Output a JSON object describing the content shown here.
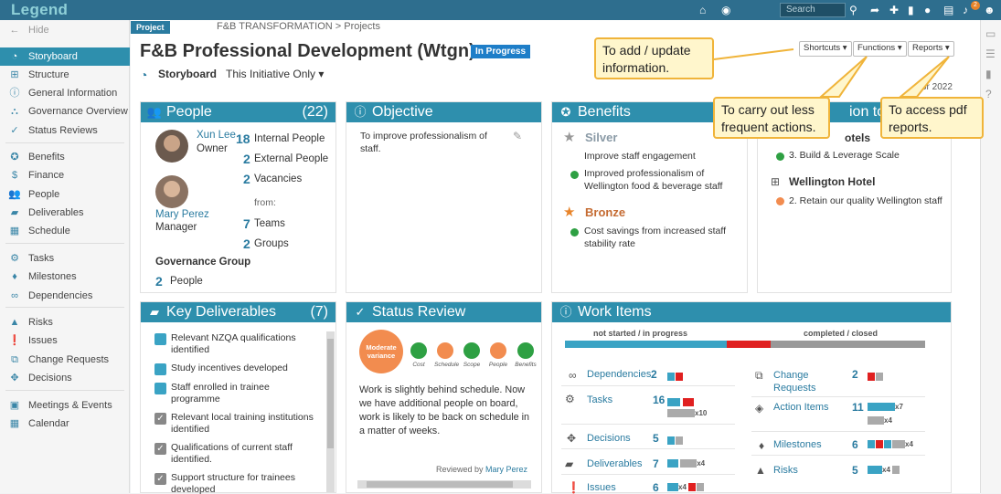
{
  "topbar": {
    "logo": "Legend",
    "search_placeholder": "Search",
    "notification_count": "2"
  },
  "sidebar": {
    "hide": "Hide",
    "items": [
      {
        "label": "Storyboard",
        "icon": "dashboard-icon"
      },
      {
        "label": "Structure",
        "icon": "sitemap-icon"
      },
      {
        "label": "General Information",
        "icon": "info-icon"
      },
      {
        "label": "Governance Overview",
        "icon": "governance-icon"
      },
      {
        "label": "Status Reviews",
        "icon": "check-double-icon"
      },
      {
        "label": "Benefits",
        "icon": "award-icon"
      },
      {
        "label": "Finance",
        "icon": "dollar-icon"
      },
      {
        "label": "People",
        "icon": "people-icon"
      },
      {
        "label": "Deliverables",
        "icon": "truck-icon"
      },
      {
        "label": "Schedule",
        "icon": "calendar-icon"
      },
      {
        "label": "Tasks",
        "icon": "cogs-icon"
      },
      {
        "label": "Milestones",
        "icon": "diamond-icon"
      },
      {
        "label": "Dependencies",
        "icon": "link-icon"
      },
      {
        "label": "Risks",
        "icon": "warning-icon"
      },
      {
        "label": "Issues",
        "icon": "exclamation-icon"
      },
      {
        "label": "Change Requests",
        "icon": "change-icon"
      },
      {
        "label": "Decisions",
        "icon": "arrows-icon"
      },
      {
        "label": "Meetings & Events",
        "icon": "calendar-event-icon"
      },
      {
        "label": "Calendar",
        "icon": "calendar-grid-icon"
      }
    ]
  },
  "header": {
    "tag": "Project",
    "breadcrumb": "F&B TRANSFORMATION > Projects",
    "title": "F&B Professional Development (Wtgn)",
    "status": "In Progress",
    "view": "Storyboard",
    "filter": "This Initiative Only",
    "shortcuts": "Shortcuts",
    "functions": "Functions",
    "reports": "Reports",
    "date_partial": "or 2022"
  },
  "callouts": {
    "update": "To add / update information.",
    "functions": "To carry out less frequent actions.",
    "reports": "To access pdf reports."
  },
  "people": {
    "title": "People",
    "count": "(22)",
    "owner_name": "Xun Lee",
    "owner_role": "Owner",
    "manager_name": "Mary Perez",
    "manager_role": "Manager",
    "internal_num": "18",
    "internal_label": "Internal People",
    "external_num": "2",
    "external_label": "External People",
    "vacancies_num": "2",
    "vacancies_label": "Vacancies",
    "from": "from:",
    "teams_num": "7",
    "teams_label": "Teams",
    "groups_num": "2",
    "groups_label": "Groups",
    "gov_title": "Governance Group",
    "gov_num": "2",
    "gov_label": "People"
  },
  "objective": {
    "title": "Objective",
    "text": "To improve professionalism of staff."
  },
  "benefits": {
    "title": "Benefits",
    "silver": "Silver",
    "silver_items": [
      "Improve staff engagement",
      "Improved professionalism of Wellington food & beverage staff"
    ],
    "bronze": "Bronze",
    "bronze_items": [
      "Cost savings from increased staff stability rate"
    ]
  },
  "contribution": {
    "title_partial": "ion to",
    "hotels_partial": "otels",
    "item1": "3. Build & Leverage Scale",
    "org2": "Wellington Hotel",
    "item2": "2. Retain our quality Wellington staff"
  },
  "deliverables": {
    "title": "Key Deliverables",
    "count": "(7)",
    "items": [
      {
        "label": "Relevant NZQA qualifications identified",
        "done": false
      },
      {
        "label": "Study incentives developed",
        "done": false
      },
      {
        "label": "Staff enrolled in trainee programme",
        "done": false
      },
      {
        "label": "Relevant local training institutions identified",
        "done": true
      },
      {
        "label": "Qualifications of current staff identified.",
        "done": true
      },
      {
        "label": "Support structure for trainees developed",
        "done": true
      }
    ]
  },
  "status_review": {
    "title": "Status Review",
    "overall": "Moderate variance",
    "indicators": [
      {
        "label": "Cost",
        "color": "#2ea043"
      },
      {
        "label": "Schedule",
        "color": "#f28c4f"
      },
      {
        "label": "Scope",
        "color": "#2ea043"
      },
      {
        "label": "People",
        "color": "#f28c4f"
      },
      {
        "label": "Benefits",
        "color": "#2ea043"
      }
    ],
    "text": "Work is slightly behind schedule. Now we have additional people on board, work is likely to be back on schedule in a matter of weeks.",
    "reviewed_by": "Reviewed by",
    "reviewer": "Mary Perez"
  },
  "work_items": {
    "title": "Work Items",
    "left_head": "not started / in progress",
    "right_head": "completed / closed",
    "progress": {
      "blue": 0.45,
      "red": 0.12,
      "grey": 0.43
    },
    "left": [
      {
        "label": "Dependencies",
        "count": "2",
        "icon": "link-icon",
        "extra": ""
      },
      {
        "label": "Tasks",
        "count": "16",
        "icon": "cogs-icon",
        "extra": "x10"
      },
      {
        "label": "Decisions",
        "count": "5",
        "icon": "arrows-icon",
        "extra": ""
      },
      {
        "label": "Deliverables",
        "count": "7",
        "icon": "truck-icon",
        "extra": "x4"
      },
      {
        "label": "Issues",
        "count": "6",
        "icon": "exclamation-icon",
        "extra": "x4"
      }
    ],
    "right": [
      {
        "label": "Change Requests",
        "count": "2",
        "icon": "change-icon",
        "extra": ""
      },
      {
        "label": "Action Items",
        "count": "11",
        "icon": "cube-icon",
        "extra": "x7",
        "extra2": "x4"
      },
      {
        "label": "Milestones",
        "count": "6",
        "icon": "diamond-icon",
        "extra": "x4"
      },
      {
        "label": "Risks",
        "count": "5",
        "icon": "warning-icon",
        "extra": "x4"
      }
    ]
  },
  "colors": {
    "accent": "#2e8fad",
    "topbar": "#2e6e8e",
    "callout": "#fff6cc",
    "callout_border": "#f0b43a"
  }
}
